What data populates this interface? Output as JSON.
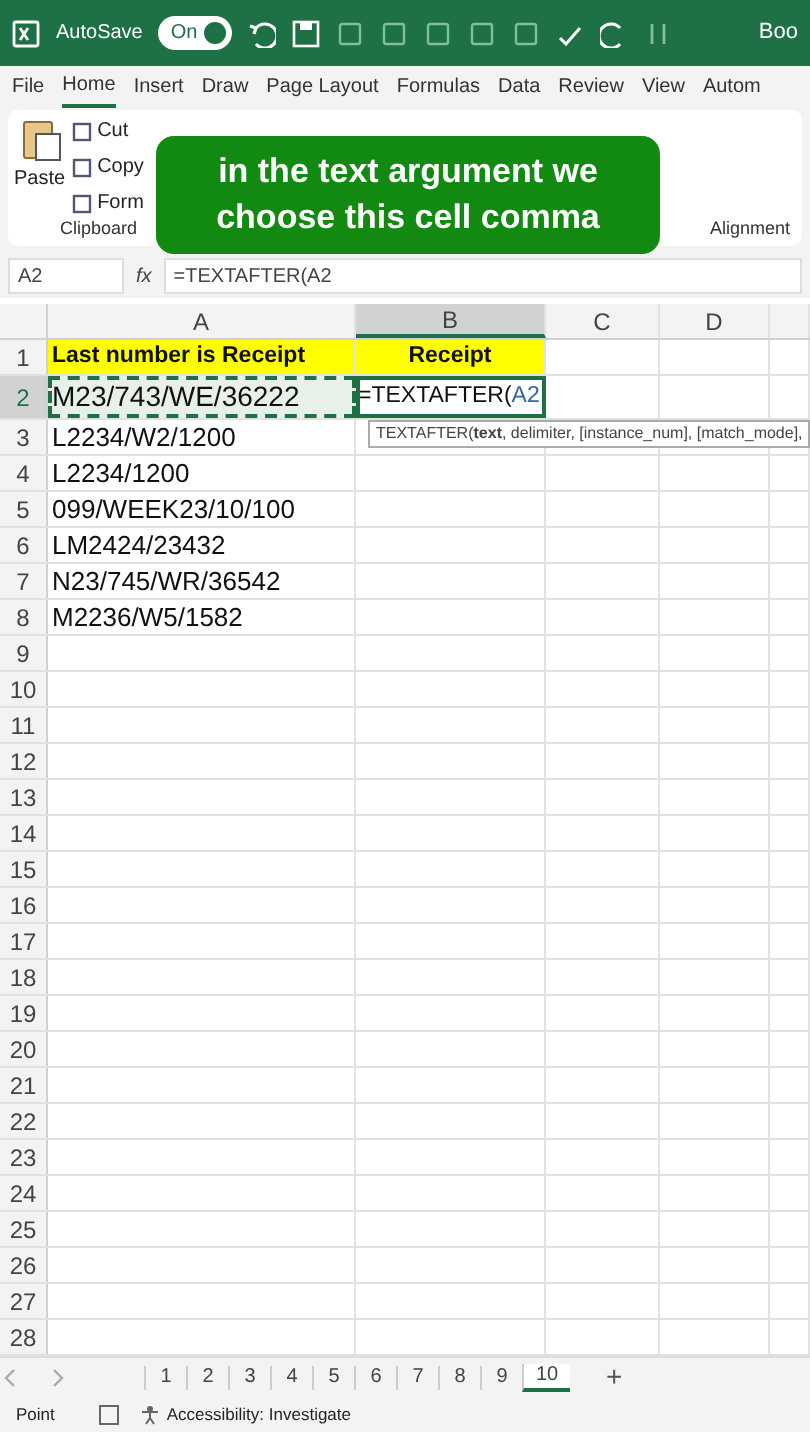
{
  "title_bar": {
    "autosave_label": "AutoSave",
    "autosave": {
      "label": "On",
      "on": true
    },
    "doc_title": "Boo"
  },
  "ribbon_tabs": [
    {
      "label": "File",
      "selected": false
    },
    {
      "label": "Home",
      "selected": true
    },
    {
      "label": "Insert",
      "selected": false
    },
    {
      "label": "Draw",
      "selected": false
    },
    {
      "label": "Page Layout",
      "selected": false
    },
    {
      "label": "Formulas",
      "selected": false
    },
    {
      "label": "Data",
      "selected": false
    },
    {
      "label": "Review",
      "selected": false
    },
    {
      "label": "View",
      "selected": false
    },
    {
      "label": "Autom",
      "selected": false
    }
  ],
  "clipboard": {
    "paste": "Paste",
    "cut": "Cut",
    "copy": "Copy",
    "format_painter": "Form",
    "group_label": "Clipboard"
  },
  "alignment_label": "Alignment",
  "caption": "in the text argument we choose this cell comma",
  "formula_bar": {
    "name_box": "A2",
    "fx": "fx",
    "formula": "=TEXTAFTER(A2"
  },
  "columns": [
    {
      "label": "A",
      "selected": false
    },
    {
      "label": "B",
      "selected": true
    },
    {
      "label": "C",
      "selected": false
    },
    {
      "label": "D",
      "selected": false
    }
  ],
  "rows": [
    {
      "number": "1",
      "selected": false,
      "kind": "header",
      "cells": [
        {
          "text": "Last number is Receipt",
          "marquee": false,
          "editing": false
        },
        {
          "text": "Receipt",
          "marquee": false,
          "editing": false
        }
      ]
    },
    {
      "number": "2",
      "selected": true,
      "kind": "data",
      "cells": [
        {
          "text": "M23/743/WE/36222",
          "marquee": true,
          "editing": false
        },
        {
          "text": "=TEXTAFTER(",
          "ref": "A2",
          "marquee": false,
          "editing": true
        }
      ]
    },
    {
      "number": "3",
      "selected": false,
      "kind": "data",
      "cells": [
        {
          "text": "L2234/W2/1200",
          "marquee": false,
          "editing": false
        }
      ]
    },
    {
      "number": "4",
      "selected": false,
      "kind": "data",
      "cells": [
        {
          "text": "L2234/1200",
          "marquee": false,
          "editing": false
        }
      ]
    },
    {
      "number": "5",
      "selected": false,
      "kind": "data",
      "cells": [
        {
          "text": "099/WEEK23/10/100",
          "marquee": false,
          "editing": false
        }
      ]
    },
    {
      "number": "6",
      "selected": false,
      "kind": "data",
      "cells": [
        {
          "text": "LM2424/23432",
          "marquee": false,
          "editing": false
        }
      ]
    },
    {
      "number": "7",
      "selected": false,
      "kind": "data",
      "cells": [
        {
          "text": "N23/745/WR/36542",
          "marquee": false,
          "editing": false
        }
      ]
    },
    {
      "number": "8",
      "selected": false,
      "kind": "data",
      "cells": [
        {
          "text": "M2236/W5/1582",
          "marquee": false,
          "editing": false
        }
      ]
    },
    {
      "number": "9",
      "selected": false
    },
    {
      "number": "10",
      "selected": false
    },
    {
      "number": "11",
      "selected": false
    },
    {
      "number": "12",
      "selected": false
    },
    {
      "number": "13",
      "selected": false
    },
    {
      "number": "14",
      "selected": false
    },
    {
      "number": "15",
      "selected": false
    },
    {
      "number": "16",
      "selected": false
    },
    {
      "number": "17",
      "selected": false
    },
    {
      "number": "18",
      "selected": false
    },
    {
      "number": "19",
      "selected": false
    },
    {
      "number": "20",
      "selected": false
    },
    {
      "number": "21",
      "selected": false
    },
    {
      "number": "22",
      "selected": false
    },
    {
      "number": "23",
      "selected": false
    },
    {
      "number": "24",
      "selected": false
    },
    {
      "number": "25",
      "selected": false
    },
    {
      "number": "26",
      "selected": false
    },
    {
      "number": "27",
      "selected": false
    },
    {
      "number": "28",
      "selected": false
    }
  ],
  "tooltip": "TEXTAFTER(**text**, delimiter, [instance_num], [match_mode],",
  "sheet_tabs": [
    {
      "label": "1",
      "selected": false
    },
    {
      "label": "2",
      "selected": false
    },
    {
      "label": "3",
      "selected": false
    },
    {
      "label": "4",
      "selected": false
    },
    {
      "label": "5",
      "selected": false
    },
    {
      "label": "6",
      "selected": false
    },
    {
      "label": "7",
      "selected": false
    },
    {
      "label": "8",
      "selected": false
    },
    {
      "label": "9",
      "selected": false
    },
    {
      "label": "10",
      "selected": true
    }
  ],
  "add_sheet": "+",
  "status_bar": {
    "mode": "Point",
    "accessibility": "Accessibility: Investigate"
  }
}
